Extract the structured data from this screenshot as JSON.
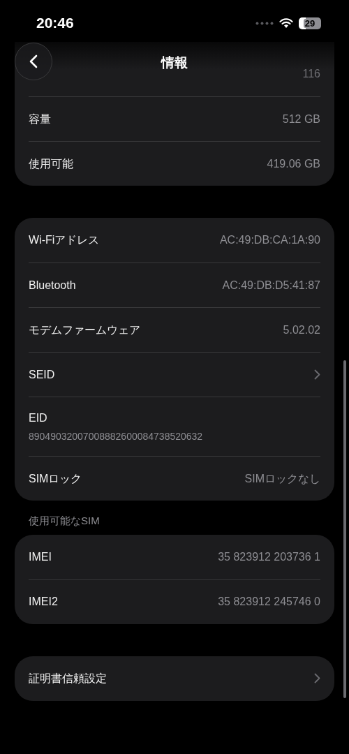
{
  "status_bar": {
    "time": "20:46",
    "battery": "29"
  },
  "header": {
    "title": "情報"
  },
  "groups": [
    {
      "rows": [
        {
          "kind": "value_only",
          "value": "116"
        },
        {
          "kind": "value",
          "label": "容量",
          "value": "512 GB"
        },
        {
          "kind": "value",
          "label": "使用可能",
          "value": "419.06 GB"
        }
      ]
    },
    {
      "rows": [
        {
          "kind": "value",
          "label": "Wi-Fiアドレス",
          "value": "AC:49:DB:CA:1A:90"
        },
        {
          "kind": "value",
          "label": "Bluetooth",
          "value": "AC:49:DB:D5:41:87"
        },
        {
          "kind": "value",
          "label": "モデムファームウェア",
          "value": "5.02.02"
        },
        {
          "kind": "chevron",
          "label": "SEID"
        },
        {
          "kind": "stacked",
          "label": "EID",
          "value": "89049032007008882600084738520632"
        },
        {
          "kind": "value",
          "label": "SIMロック",
          "value": "SIMロックなし"
        }
      ]
    },
    {
      "title": "使用可能なSIM",
      "rows": [
        {
          "kind": "value",
          "label": "IMEI",
          "value": "35 823912 203736 1"
        },
        {
          "kind": "value",
          "label": "IMEI2",
          "value": "35 823912 245746 0"
        }
      ]
    },
    {
      "rows": [
        {
          "kind": "chevron",
          "label": "証明書信頼設定"
        }
      ]
    }
  ]
}
